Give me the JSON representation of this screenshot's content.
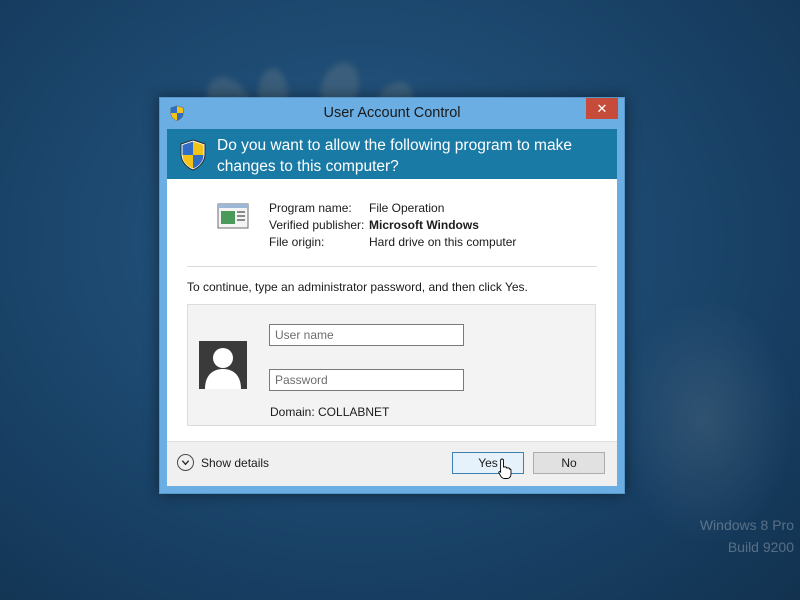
{
  "dialog": {
    "title": "User Account Control",
    "close_icon": "close-icon",
    "question": "Do you want to allow the following program to make changes to this computer?",
    "program": {
      "name_label": "Program name:",
      "name_value": "File Operation",
      "publisher_label": "Verified publisher:",
      "publisher_value": "Microsoft Windows",
      "origin_label": "File origin:",
      "origin_value": "Hard drive on this computer"
    },
    "instruction": "To continue, type an administrator password, and then click Yes.",
    "credentials": {
      "username_placeholder": "User name",
      "password_placeholder": "Password",
      "domain": "Domain: COLLABNET"
    },
    "footer": {
      "show_details": "Show details",
      "yes_label": "Yes",
      "no_label": "No"
    }
  },
  "desktop": {
    "watermark_line1": "Windows 8 Pro",
    "watermark_line2": "Build 9200"
  },
  "colors": {
    "header_bg": "#1a7aa6",
    "frame": "#6aaee3",
    "close_button": "#c74b3b"
  },
  "icons": [
    "shield-icon",
    "program-icon",
    "user-tile-icon",
    "chevron-down-icon",
    "close-icon",
    "mouse-cursor-icon"
  ]
}
